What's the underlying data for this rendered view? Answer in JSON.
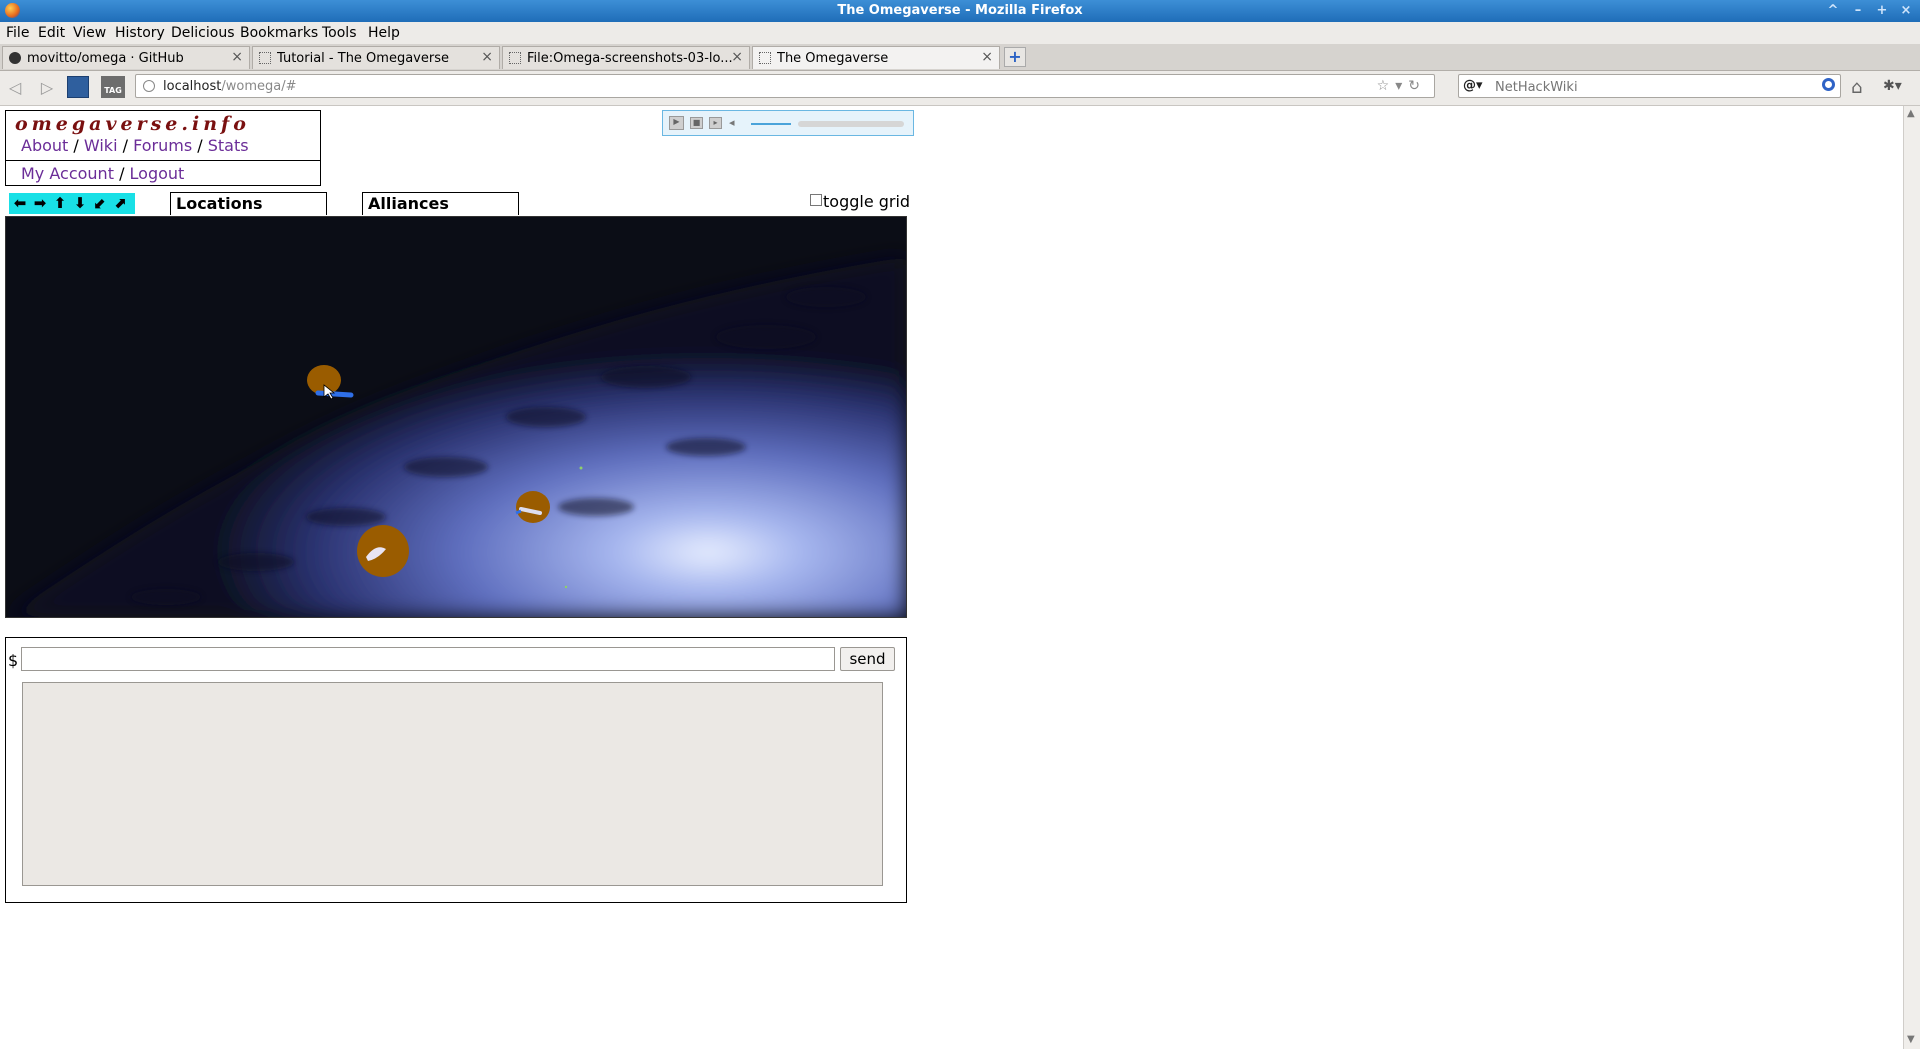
{
  "window": {
    "title": "The Omegaverse - Mozilla Firefox"
  },
  "menu": [
    "File",
    "Edit",
    "View",
    "History",
    "Delicious",
    "Bookmarks",
    "Tools",
    "Help"
  ],
  "tabs": [
    {
      "label": "movitto/omega · GitHub",
      "active": false
    },
    {
      "label": "Tutorial - The Omegaverse",
      "active": false
    },
    {
      "label": "File:Omega-screenshots-03-lo...",
      "active": false
    },
    {
      "label": "The Omegaverse",
      "active": true
    }
  ],
  "urlbar": {
    "host": "localhost",
    "path": "/womega/#"
  },
  "searchbar": {
    "engine": "@",
    "placeholder": "NetHackWiki"
  },
  "site": {
    "title": "omegaverse.info",
    "links": {
      "about": "About",
      "wiki": "Wiki",
      "forums": "Forums",
      "stats": "Stats",
      "sep": "/"
    },
    "account": {
      "my_account": "My Account",
      "logout": "Logout"
    }
  },
  "controls": {
    "locations": "Locations",
    "alliances": "Alliances",
    "toggle_grid": "toggle grid"
  },
  "console": {
    "prompt": "$",
    "input_value": "",
    "send_label": "send",
    "output": ""
  },
  "colors": {
    "site_title": "#7a1010",
    "link": "#6b2d98",
    "nav_arrows_bg": "#19e0e6",
    "planet": "#9a5c00",
    "ship": "#2f6fe8"
  }
}
